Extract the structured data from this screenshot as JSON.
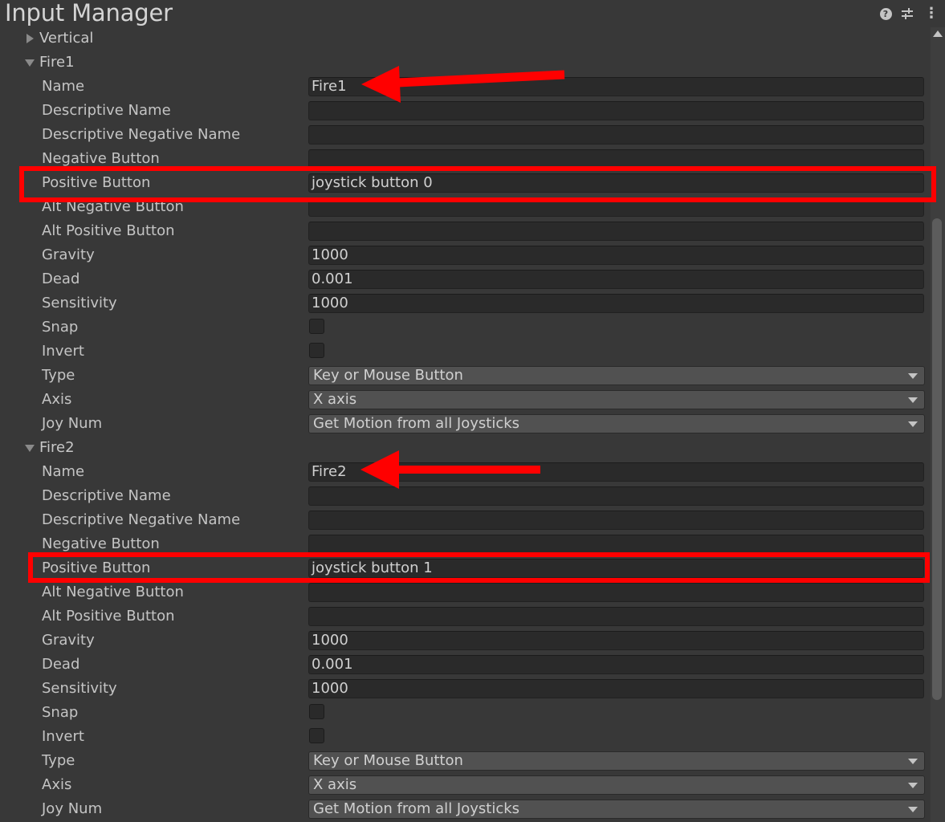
{
  "window": {
    "title": "Input Manager"
  },
  "header_icons": [
    "help-icon",
    "settings-icon",
    "more-icon"
  ],
  "collapsed_axis": {
    "label": "Vertical"
  },
  "axes": [
    {
      "label": "Fire1",
      "name": "Fire1",
      "descriptive_name": "",
      "descriptive_negative_name": "",
      "negative_button": "",
      "positive_button": "joystick button 0",
      "alt_negative_button": "",
      "alt_positive_button": "",
      "gravity": "1000",
      "dead": "0.001",
      "sensitivity": "1000",
      "snap": false,
      "invert": false,
      "type": "Key or Mouse Button",
      "axis": "X axis",
      "joy_num": "Get Motion from all Joysticks"
    },
    {
      "label": "Fire2",
      "name": "Fire2",
      "descriptive_name": "",
      "descriptive_negative_name": "",
      "negative_button": "",
      "positive_button": "joystick button 1",
      "alt_negative_button": "",
      "alt_positive_button": "",
      "gravity": "1000",
      "dead": "0.001",
      "sensitivity": "1000",
      "snap": false,
      "invert": false,
      "type": "Key or Mouse Button",
      "axis": "X axis",
      "joy_num": "Get Motion from all Joysticks"
    }
  ],
  "labels": {
    "name": "Name",
    "descriptive_name": "Descriptive Name",
    "descriptive_negative_name": "Descriptive Negative Name",
    "negative_button": "Negative Button",
    "positive_button": "Positive Button",
    "alt_negative_button": "Alt Negative Button",
    "alt_positive_button": "Alt Positive Button",
    "gravity": "Gravity",
    "dead": "Dead",
    "sensitivity": "Sensitivity",
    "snap": "Snap",
    "invert": "Invert",
    "type": "Type",
    "axis": "Axis",
    "joy_num": "Joy Num"
  },
  "annotation_color": "#ff0000"
}
